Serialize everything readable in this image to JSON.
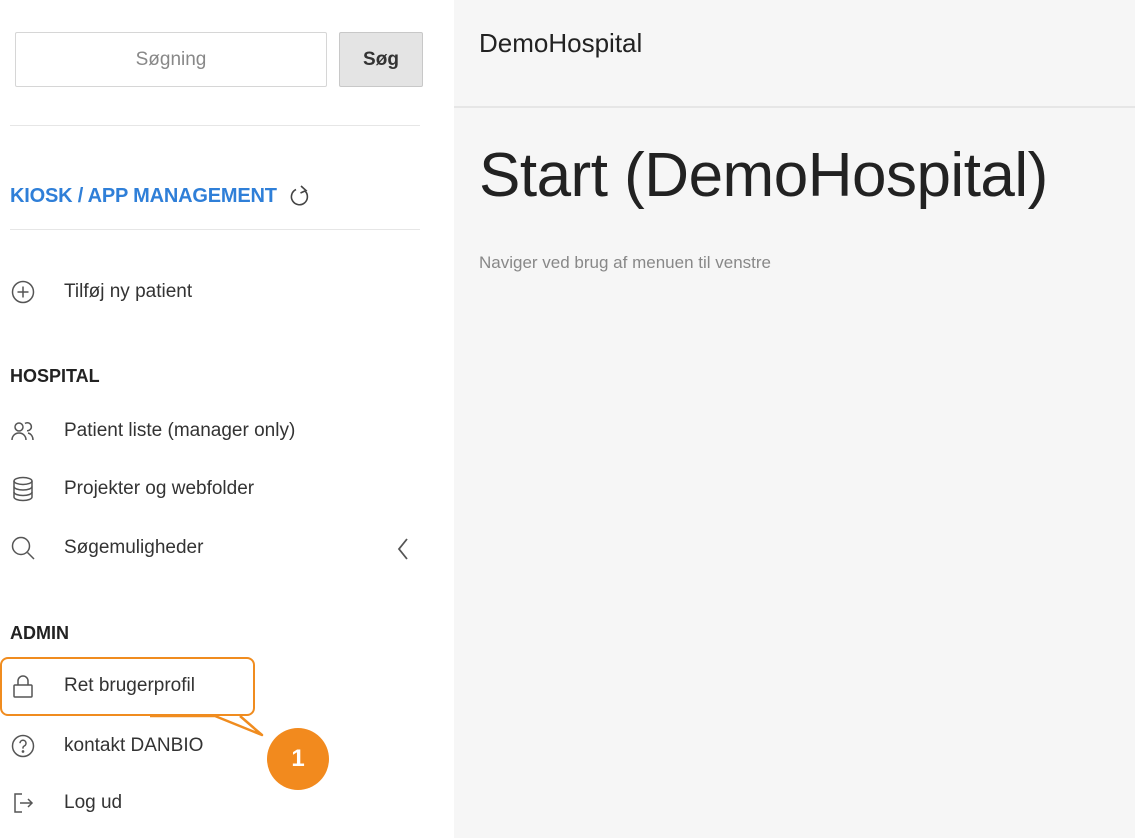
{
  "search": {
    "placeholder": "Søgning",
    "button_label": "Søg"
  },
  "sidebar": {
    "kiosk_label": "KIOSK / APP MANAGEMENT",
    "add_patient_label": "Tilføj ny patient",
    "sections": {
      "hospital": {
        "title": "HOSPITAL",
        "items": [
          {
            "label": "Patient liste (manager only)",
            "icon": "users-icon"
          },
          {
            "label": "Projekter og webfolder",
            "icon": "database-icon"
          },
          {
            "label": "Søgemuligheder",
            "icon": "search-icon"
          }
        ]
      },
      "admin": {
        "title": "ADMIN",
        "items": [
          {
            "label": "Ret brugerprofil",
            "icon": "lock-icon"
          },
          {
            "label": "kontakt DANBIO",
            "icon": "help-circle-icon"
          },
          {
            "label": "Log ud",
            "icon": "logout-icon"
          }
        ]
      }
    }
  },
  "callout": {
    "number": "1",
    "color": "#f28a1e"
  },
  "main": {
    "header_title": "DemoHospital",
    "page_title": "Start (DemoHospital)",
    "subtitle": "Naviger ved brug af menuen til venstre"
  },
  "colors": {
    "accent": "#2f7fd8",
    "callout": "#f08c1f",
    "main_bg": "#f6f6f6"
  }
}
